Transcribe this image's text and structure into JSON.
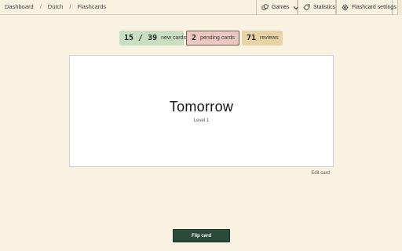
{
  "breadcrumb": {
    "items": [
      "Dashboard",
      "Dutch",
      "Flashcards"
    ],
    "separator": "/"
  },
  "nav": {
    "games_label": "Games",
    "statistics_label": "Statistics",
    "settings_label": "Flashcard settings"
  },
  "stats": {
    "new": {
      "value": "15 / 39",
      "label": "new cards",
      "color": "#c9e0c0"
    },
    "pending": {
      "value": "2",
      "label": "pending cards",
      "color": "#edc8c0"
    },
    "reviews": {
      "value": "71",
      "label": "reviews",
      "color": "#e7d3a3"
    }
  },
  "card": {
    "word": "Tomorrow",
    "level": "Level 1"
  },
  "edit_card_label": "Edit card",
  "flip_button_label": "Flip card",
  "colors": {
    "background": "#faf2e0",
    "primary_button": "#2b4a37"
  },
  "icons": {
    "games": "dice-icon",
    "games_caret": "chevron-down-icon",
    "statistics": "tag-icon",
    "settings": "gear-icon"
  }
}
